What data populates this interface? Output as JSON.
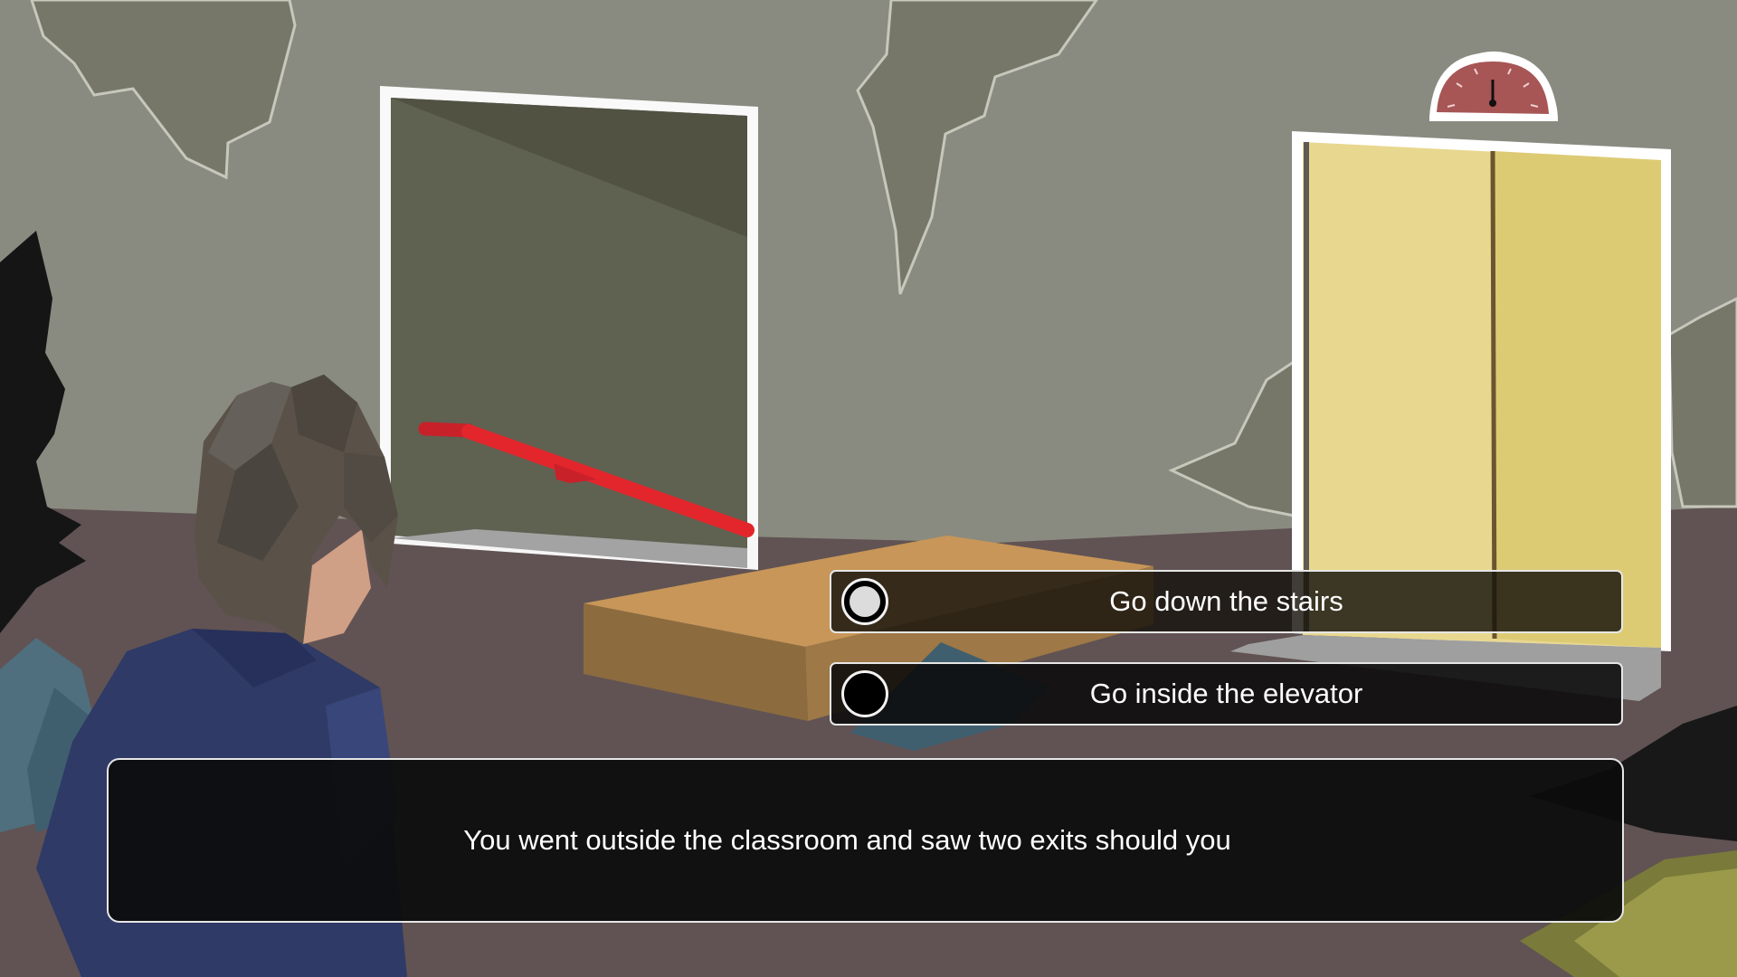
{
  "colors": {
    "wall": "#8a8b80",
    "floor": "#615353",
    "doorway_interior": "#5f6151",
    "handrail": "#e3262c",
    "elevator_door": "#e8d88f",
    "floor_indicator": "#a75555",
    "character_jacket": "#2f3a66",
    "character_hair": "#5a5248",
    "box": "#c79658"
  },
  "scene": {
    "left_exit": "stairs-doorway",
    "right_exit": "elevator"
  },
  "choices": [
    {
      "label": "Go down the stairs",
      "selected": true
    },
    {
      "label": "Go inside the elevator",
      "selected": false
    }
  ],
  "dialogue": {
    "text": "You went outside the classroom and saw two exits should you"
  }
}
